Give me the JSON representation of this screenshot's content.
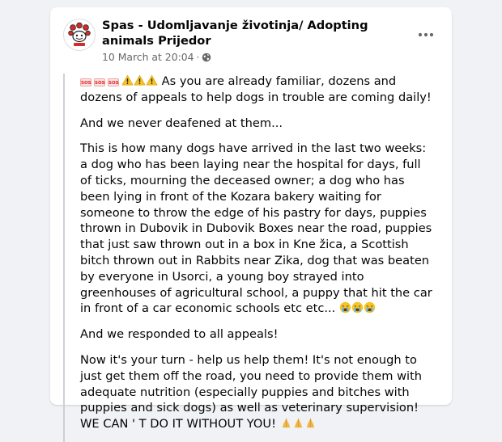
{
  "post": {
    "page_name": "Spas - Udomljavanje životinja/ Adopting animals Prijedor",
    "date": "10 March at 20:04",
    "separator": "·",
    "visibility_icon": "globe-icon",
    "more_icon": "more-options-icon",
    "paragraphs": {
      "p1": "As you are already familiar, dozens and dozens of appeals to help dogs in trouble are coming daily!",
      "p2": "And we never deafened at them...",
      "p3": "This is how many dogs have arrived in the last two weeks: a dog who has been laying near the hospital for days, full of ticks, mourning the deceased owner; a dog who has been lying in front of the Kozara bakery waiting for someone to throw the edge of his pastry for days, puppies thrown in Dubovik in Dubovik Boxes near the road, puppies that just saw thrown out in a box in Kne žica, a Scottish bitch thrown out in Rabbits near Zika, dog that was beaten by everyone in Usorci, a young boy strayed into greenhouses of agricultural school, a puppy that hit the car in front of a car economic schools etc etc...",
      "p4": "And we responded to all appeals!",
      "p5": "Now it's your turn - help us help them! It's not enough to just get them off the road, you need to provide them with adequate nutrition (especially puppies and bitches with puppies and sick dogs) as well as veterinary supervision! WE CAN ' T DO IT WITHOUT YOU!"
    },
    "sos_label": "SOS",
    "emoji": {
      "p1_prefix": [
        "sos-icon",
        "sos-icon",
        "sos-icon",
        "warning-icon",
        "warning-icon",
        "warning-icon"
      ],
      "p3_suffix": [
        "crying-face-icon",
        "crying-face-icon",
        "crying-face-icon"
      ],
      "p5_suffix": [
        "folded-hands-icon",
        "folded-hands-icon",
        "folded-hands-icon"
      ]
    },
    "colors": {
      "text": "#050505",
      "secondary_text": "#65676b",
      "background": "#f0f2f5",
      "card": "#ffffff",
      "quote_bar": "#ced0d4"
    }
  }
}
